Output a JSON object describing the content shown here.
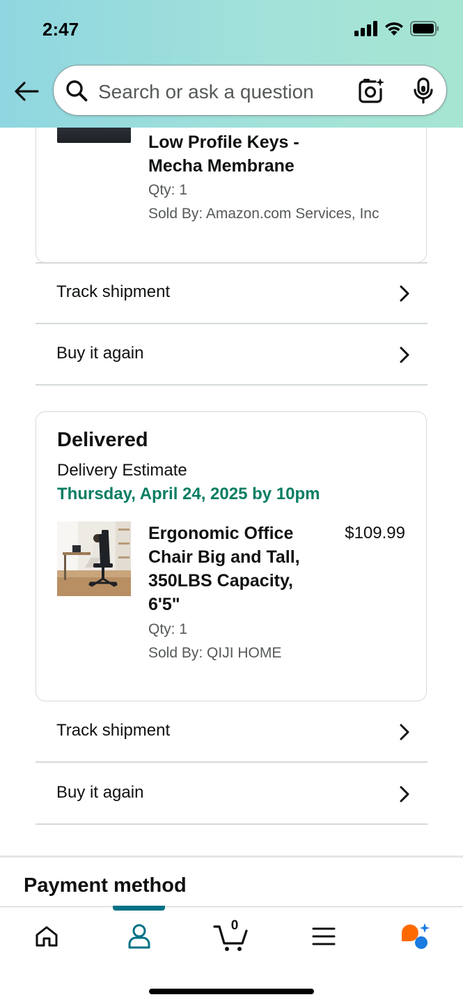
{
  "status_bar": {
    "time": "2:47",
    "icons": [
      "signal-icon",
      "wifi-icon",
      "battery-icon"
    ]
  },
  "header": {
    "back_icon": "back-arrow-icon",
    "search": {
      "placeholder": "Search or ask a question",
      "icons": [
        "search-icon",
        "camera-lens-icon",
        "microphone-icon"
      ]
    }
  },
  "order_items": [
    {
      "title_visible_lines": [
        "Low Profile Keys -",
        "Mecha Membrane"
      ],
      "qty": "Qty: 1",
      "sold_by": "Sold By: Amazon.com Services, Inc"
    },
    {
      "status": "Delivered",
      "delivery_estimate_label": "Delivery Estimate",
      "delivery_date": "Thursday, April 24, 2025 by 10pm",
      "title_lines": [
        "Ergonomic Office",
        "Chair Big and Tall,",
        "350LBS Capacity,",
        "6'5\""
      ],
      "price": "$109.99",
      "qty": "Qty: 1",
      "sold_by": "Sold By: QIJI HOME"
    }
  ],
  "actions": {
    "track_shipment": "Track shipment",
    "buy_it_again": "Buy it again"
  },
  "payment": {
    "title": "Payment method"
  },
  "bottom_nav": {
    "items": [
      "home-icon",
      "account-icon",
      "cart-icon",
      "menu-icon",
      "rufus-assistant-icon"
    ],
    "active": "account-icon",
    "cart_count": "0"
  },
  "colors": {
    "header_gradient_start": "#8fd6e0",
    "header_gradient_end": "#a6e5d2",
    "delivery_date_green": "#067d62",
    "active_nav_teal": "#007185",
    "assistant_orange": "#ff6a00",
    "assistant_blue": "#1a7be0"
  }
}
